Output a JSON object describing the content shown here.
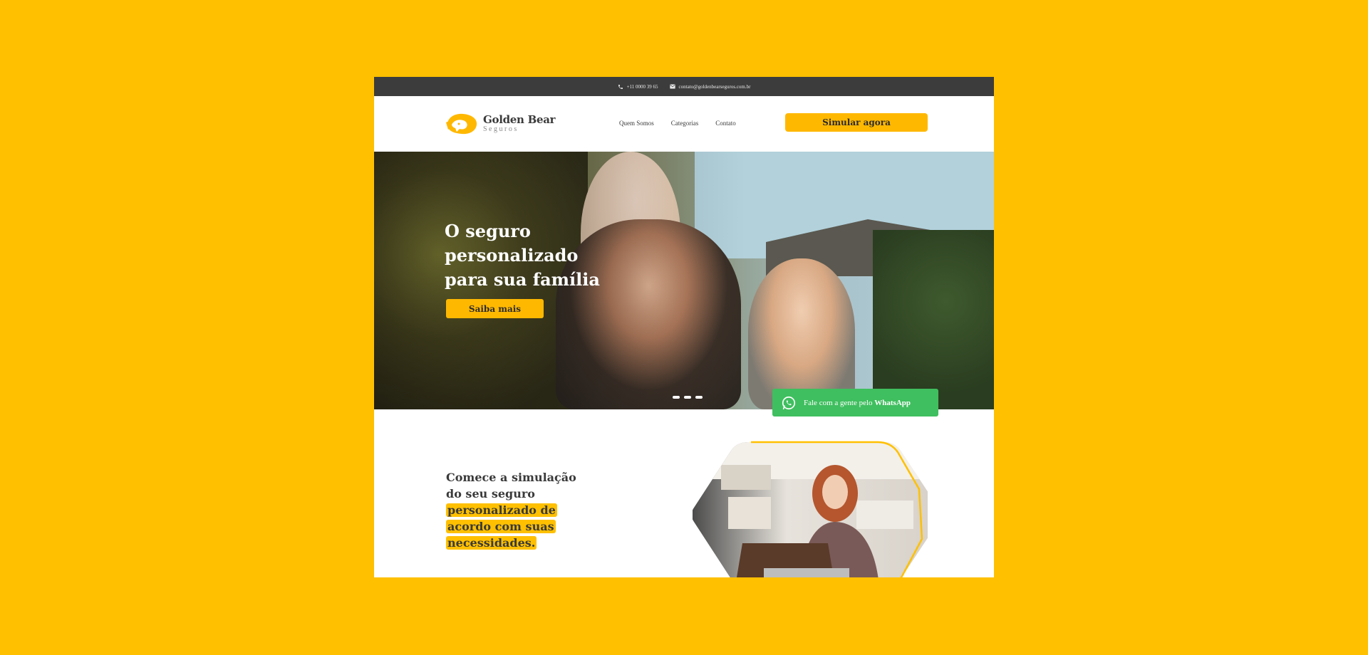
{
  "topbar": {
    "phone": "+11 0000 39 65",
    "email": "contato@goldenbearseguros.com.br"
  },
  "header": {
    "logo_name": "Golden Bear",
    "logo_sub": "Seguros",
    "nav": [
      {
        "label": "Quem Somos"
      },
      {
        "label": "Categorias"
      },
      {
        "label": "Contato"
      }
    ],
    "cta": "Simular agora"
  },
  "hero": {
    "title_line1": "O seguro",
    "title_line2": "personalizado",
    "title_line3": "para sua família",
    "button": "Saiba mais",
    "slides": 3,
    "active_slide": 1
  },
  "whatsapp": {
    "text": "Fale com a gente pelo",
    "brand": "WhatsApp"
  },
  "section": {
    "line1": "Comece a simulação",
    "line2": "do seu seguro",
    "highlight1": "personalizado de",
    "highlight2": "acordo com suas",
    "highlight3": "necessidades."
  },
  "colors": {
    "background": "#FFC000",
    "accent": "#FFB800",
    "topbar": "#3c3c3c",
    "whatsapp": "#3fbf5f"
  },
  "icons": [
    "phone-icon",
    "mail-icon",
    "bear-logo-icon",
    "whatsapp-icon"
  ]
}
